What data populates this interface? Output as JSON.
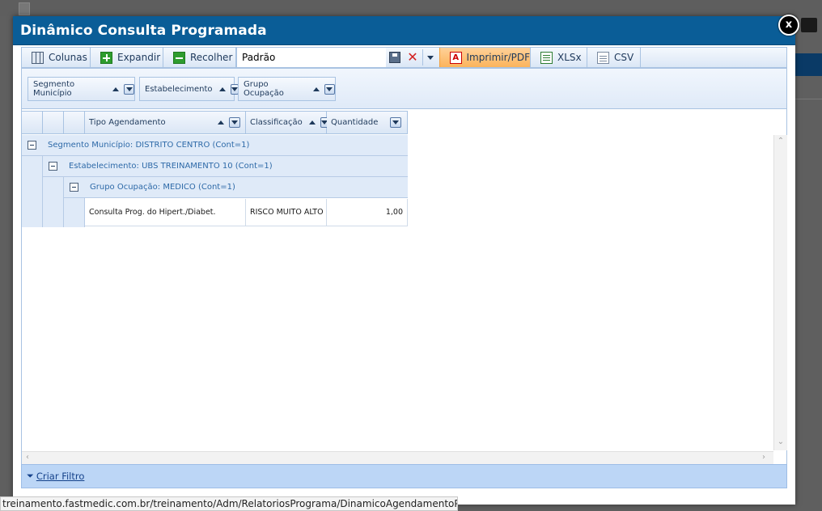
{
  "dialog": {
    "title": "Dinâmico Consulta Programada",
    "close_label": "x"
  },
  "toolbar": {
    "columns_label": "Colunas",
    "expand_label": "Expandir",
    "collapse_label": "Recolher",
    "layout_value": "Padrão",
    "pdf_label": "Imprimir/PDF",
    "xlsx_label": "XLSx",
    "csv_label": "CSV"
  },
  "group_panel": {
    "chips": [
      {
        "label": "Segmento Município"
      },
      {
        "label": "Estabelecimento"
      },
      {
        "label": "Grupo Ocupação"
      }
    ]
  },
  "grid": {
    "columns": [
      {
        "label": "Tipo Agendamento"
      },
      {
        "label": "Classificação"
      },
      {
        "label": "Quantidade"
      }
    ],
    "groups": [
      {
        "label": "Segmento Município: DISTRITO CENTRO (Cont=1)"
      },
      {
        "label": "Estabelecimento: UBS TREINAMENTO 10 (Cont=1)"
      },
      {
        "label": "Grupo Ocupação: MEDICO (Cont=1)"
      }
    ],
    "rows": [
      {
        "tipo": "Consulta Prog. do Hipert./Diabet.",
        "classificacao": "RISCO MUITO ALTO",
        "quantidade": "1,00"
      }
    ]
  },
  "footer": {
    "filter_link": "Criar Filtro"
  },
  "status_bar": {
    "url": "treinamento.fastmedic.com.br/treinamento/Adm/RelatoriosPrograma/DinamicoAgendamentoPrograma#"
  }
}
